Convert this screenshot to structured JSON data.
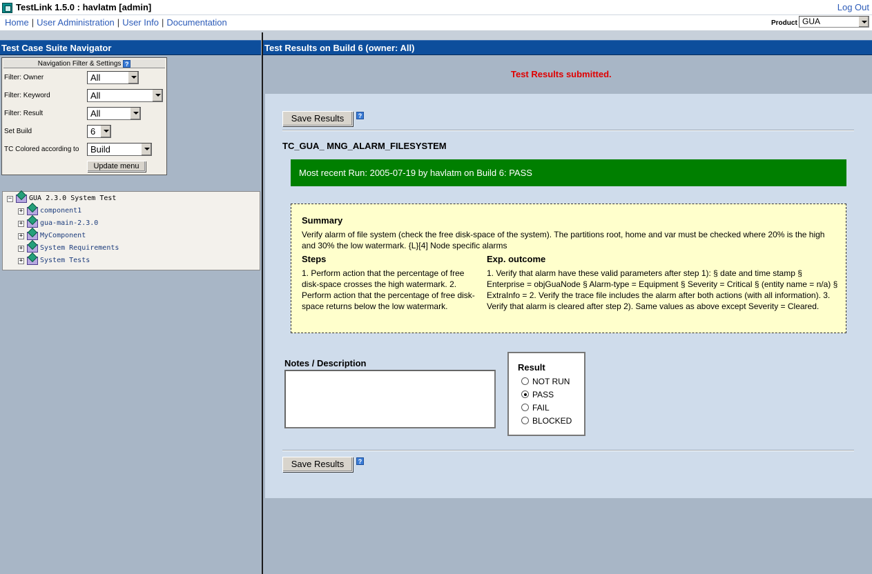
{
  "app": {
    "title": "TestLink 1.5.0 : havlatm [admin]",
    "logout": "Log Out"
  },
  "nav": {
    "home": "Home",
    "user_admin": "User Administration",
    "user_info": "User Info",
    "documentation": "Documentation",
    "separator": "|"
  },
  "product": {
    "label": "Product",
    "value": "GUA"
  },
  "left_panel": {
    "title": "Test Case Suite Navigator",
    "filter": {
      "title": "Navigation Filter & Settings",
      "help": "?",
      "owner_label": "Filter: Owner",
      "owner_value": "All",
      "keyword_label": "Filter: Keyword",
      "keyword_value": "All",
      "result_label": "Filter: Result",
      "result_value": "All",
      "build_label": "Set Build",
      "build_value": "6",
      "colored_label": "TC Colored according to",
      "colored_value": "Build",
      "update_button": "Update menu"
    },
    "tree": {
      "root": "GUA 2.3.0 System Test",
      "items": [
        "component1",
        "gua-main-2.3.0",
        "MyComponent",
        "System Requirements",
        "System Tests"
      ]
    }
  },
  "right_panel": {
    "title": "Test Results on Build 6 (owner: All)",
    "status_message": "Test Results submitted.",
    "save_button": "Save Results",
    "help": "?",
    "testcase_title": "TC_GUA_ MNG_ALARM_FILESYSTEM",
    "recent_run": "Most recent Run: 2005-07-19 by havlatm on Build 6: PASS",
    "summary": {
      "heading": "Summary",
      "text": "Verify alarm of file system (check the free disk-space of the system). The partitions root, home and var must be checked where 20% is the high and 30% the low watermark. {L}[4] Node specific alarms",
      "steps_heading": "Steps",
      "steps_text": "1. Perform action that the percentage of free disk-space crosses the high watermark. 2. Perform action that the percentage of free disk-space returns below the low watermark.",
      "outcome_heading": "Exp. outcome",
      "outcome_text": "1. Verify that alarm have these valid parameters after step 1): § date and time stamp § Enterprise = objGuaNode § Alarm-type = Equipment § Severity = Critical § (entity name = n/a) § ExtraInfo = 2. Verify the trace file includes the alarm after both actions (with all information). 3. Verify that alarm is cleared after step 2). Same values as above except Severity = Cleared."
    },
    "notes_label": "Notes / Description",
    "notes_value": "",
    "result": {
      "title": "Result",
      "options": [
        "NOT RUN",
        "PASS",
        "FAIL",
        "BLOCKED"
      ],
      "selected": "PASS"
    }
  },
  "colors": {
    "header_blue": "#0d4e9c",
    "pass_green": "#007f00",
    "status_red": "#e00000",
    "summary_bg": "#ffffcc"
  }
}
